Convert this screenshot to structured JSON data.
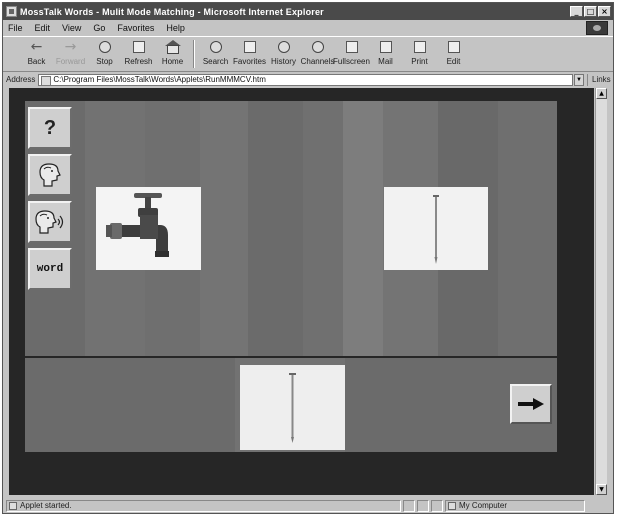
{
  "window": {
    "title": "MossTalk Words - Mulit Mode Matching - Microsoft Internet Explorer",
    "controls": [
      "_",
      "□",
      "×"
    ]
  },
  "menu": [
    "File",
    "Edit",
    "View",
    "Go",
    "Favorites",
    "Help"
  ],
  "toolbar": [
    {
      "label": "Back",
      "icon": "back-arrow-icon"
    },
    {
      "label": "Forward",
      "icon": "forward-arrow-icon",
      "disabled": true
    },
    {
      "label": "Stop",
      "icon": "stop-icon"
    },
    {
      "label": "Refresh",
      "icon": "refresh-icon"
    },
    {
      "label": "Home",
      "icon": "home-icon"
    },
    {
      "label": "Search",
      "icon": "search-icon"
    },
    {
      "label": "Favorites",
      "icon": "favorites-icon"
    },
    {
      "label": "History",
      "icon": "history-icon"
    },
    {
      "label": "Channels",
      "icon": "channels-icon"
    },
    {
      "label": "Fullscreen",
      "icon": "fullscreen-icon"
    },
    {
      "label": "Mail",
      "icon": "mail-icon"
    },
    {
      "label": "Print",
      "icon": "print-icon"
    },
    {
      "label": "Edit",
      "icon": "edit-icon"
    }
  ],
  "address": {
    "label": "Address",
    "value": "C:\\Program Files\\MossTalk\\Words\\Applets\\RunMMMCV.htm",
    "links_label": "Links"
  },
  "applet": {
    "side_buttons": [
      {
        "name": "help-button",
        "icon": "question-mark-icon",
        "text": "?"
      },
      {
        "name": "speak-button",
        "icon": "head-speaking-icon"
      },
      {
        "name": "speak-aloud-button",
        "icon": "head-speaking-loud-icon"
      },
      {
        "name": "word-button",
        "icon": "word-icon",
        "text": "word"
      }
    ],
    "choices": [
      {
        "name": "choice-card-faucet",
        "icon": "faucet-icon"
      },
      {
        "name": "choice-card-nail",
        "icon": "nail-icon"
      }
    ],
    "target": {
      "name": "target-card-nail",
      "icon": "nail-icon"
    },
    "next_button": {
      "icon": "right-arrow-icon"
    }
  },
  "status": {
    "text": "Applet started.",
    "zone": "My Computer"
  }
}
